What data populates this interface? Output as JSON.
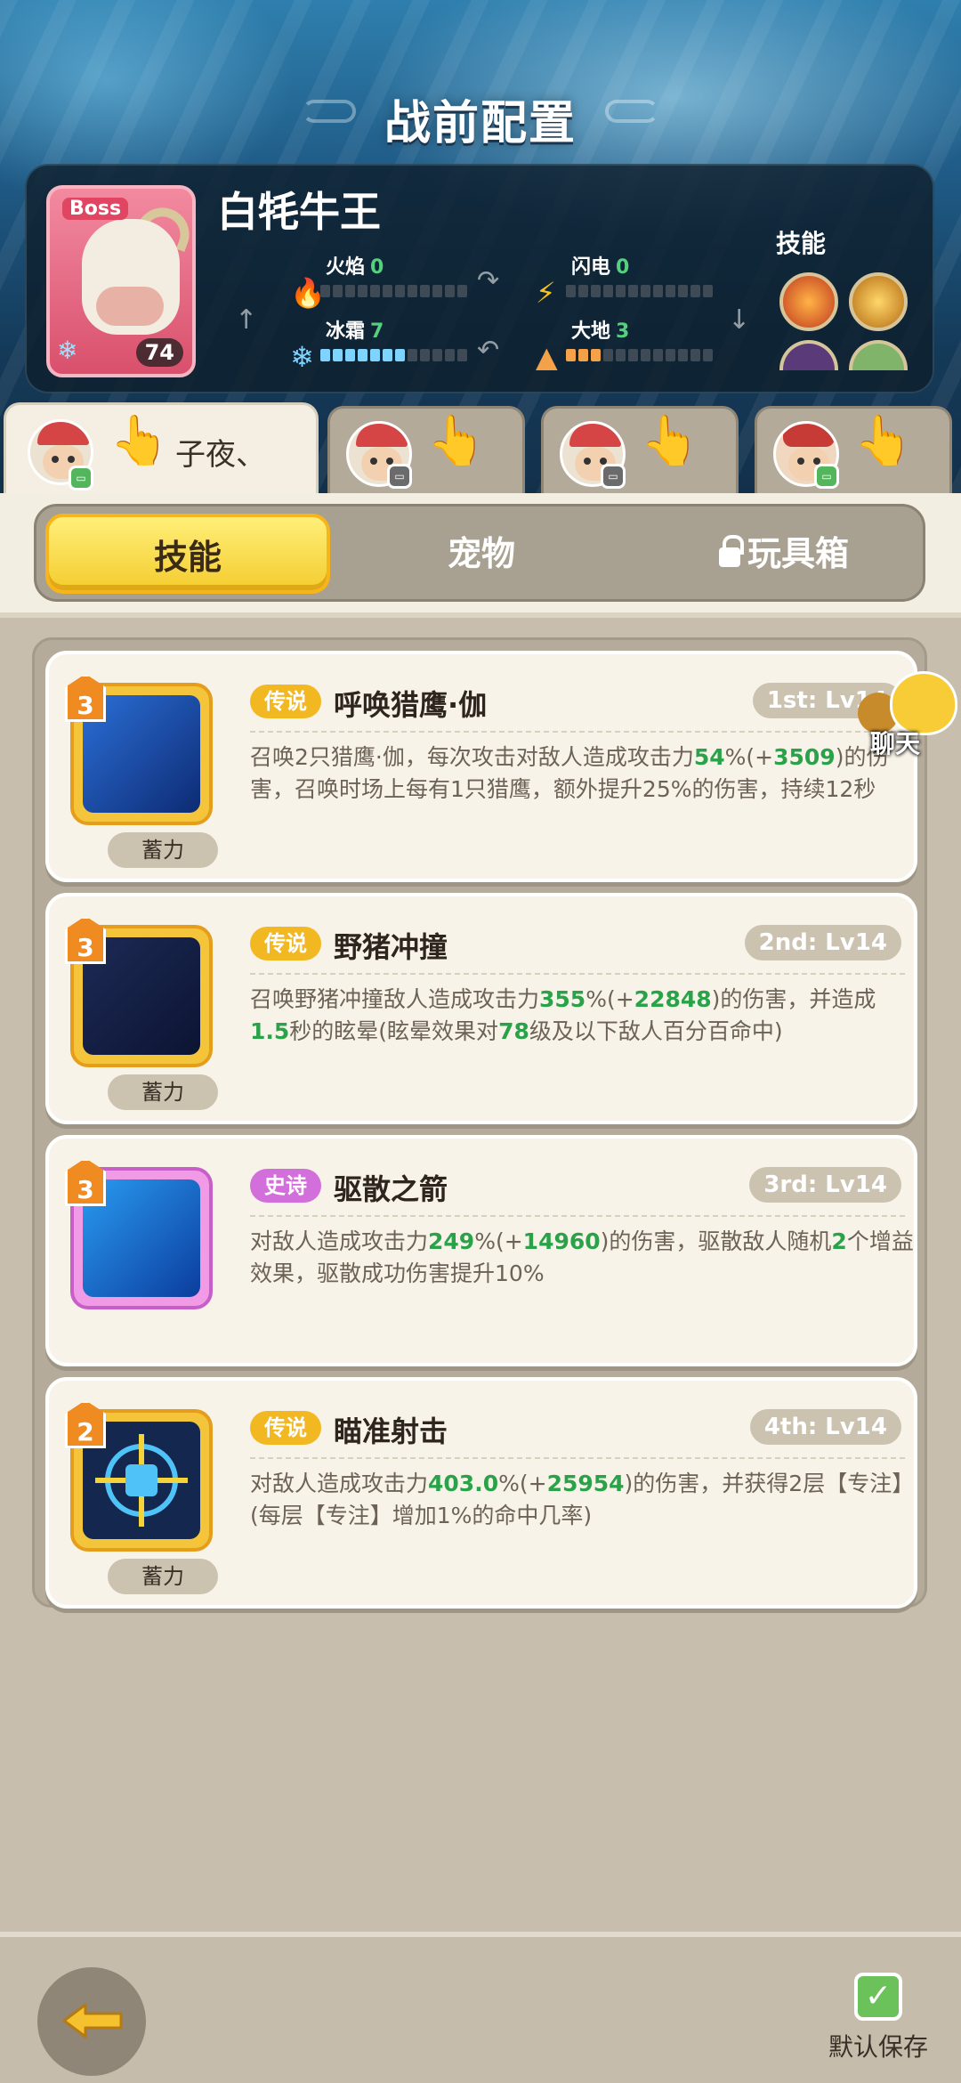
{
  "header": {
    "title": "战前配置"
  },
  "boss": {
    "tag": "Boss",
    "name": "白牦牛王",
    "level": "74",
    "elements": [
      {
        "label": "火焰",
        "value": "0",
        "fill": 0
      },
      {
        "label": "闪电",
        "value": "0",
        "fill": 0
      },
      {
        "label": "冰霜",
        "value": "7",
        "fill": 7
      },
      {
        "label": "大地",
        "value": "3",
        "fill": 3
      }
    ],
    "skills_label": "技能"
  },
  "hero_tabs": [
    {
      "name": "子夜、",
      "active": true
    },
    {
      "name": "",
      "active": false
    },
    {
      "name": "",
      "active": false
    },
    {
      "name": "",
      "active": false
    }
  ],
  "segments": {
    "skills": "技能",
    "pets": "宠物",
    "toybox": "玩具箱"
  },
  "skills": [
    {
      "rank": "3",
      "rarity": "传说",
      "name": "呼唤猎鹰·伽",
      "lvl": "1st: Lv14",
      "charge": "蓄力",
      "desc": [
        "召唤2只猎鹰·伽，每次攻击对敌人造成攻击力",
        "54",
        "%(+",
        "3509",
        ")的伤害，召唤时场上每有1只猎鹰，额外提升25%的伤害，持续12秒"
      ]
    },
    {
      "rank": "3",
      "rarity": "传说",
      "name": "野猪冲撞",
      "lvl": "2nd: Lv14",
      "charge": "蓄力",
      "desc": [
        "召唤野猪冲撞敌人造成攻击力",
        "355",
        "%(+",
        "22848",
        ")的伤害，并造成",
        "1.5",
        "秒的眩晕(眩晕效果对",
        "78",
        "级及以下敌人百分百命中)"
      ]
    },
    {
      "rank": "3",
      "rarity": "史诗",
      "name": "驱散之箭",
      "lvl": "3rd: Lv14",
      "charge": "",
      "desc": [
        "对敌人造成攻击力",
        "249",
        "%(+",
        "14960",
        ")的伤害，驱散敌人随机",
        "2",
        "个增益效果，驱散成功伤害提升10%"
      ]
    },
    {
      "rank": "2",
      "rarity": "传说",
      "name": "瞄准射击",
      "lvl": "4th: Lv14",
      "charge": "蓄力",
      "desc": [
        "对敌人造成攻击力",
        "403.0",
        "%(+",
        "25954",
        ")的伤害，并获得2层【专注】(每层【专注】增加1%的命中几率)"
      ]
    }
  ],
  "chat": {
    "label": "聊天"
  },
  "footer": {
    "save_label": "默认保存"
  },
  "colors": {
    "legendary": "#f2b821",
    "epic": "#d36fdb",
    "highlight": "#2aa24a",
    "accent_yellow": "#f4cc2f"
  }
}
